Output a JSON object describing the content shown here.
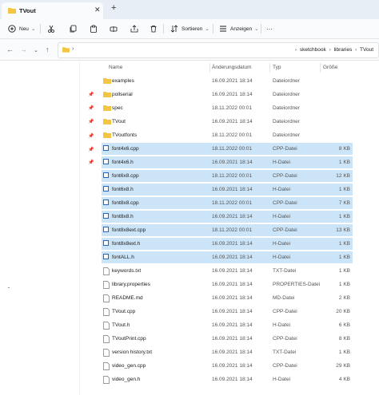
{
  "window": {
    "tab_title": "TVout",
    "colors": {
      "accent": "#0067c0",
      "selection": "#cce4f7",
      "folder": "#f4c542"
    }
  },
  "toolbar": {
    "new_label": "Neu",
    "sort_label": "Sortieren",
    "view_label": "Anzeigen",
    "more_label": "···"
  },
  "address": {
    "crumbs": [
      "sketchbook",
      "libraries",
      "TVout"
    ]
  },
  "columns": {
    "name": "Name",
    "date": "Änderungsdatum",
    "type": "Typ",
    "size": "Größe"
  },
  "files": [
    {
      "name": "examples",
      "date": "16.09.2021 18:14",
      "type": "Dateiordner",
      "size": "",
      "kind": "folder",
      "selected": false
    },
    {
      "name": "pollserial",
      "date": "16.09.2021 18:14",
      "type": "Dateiordner",
      "size": "",
      "kind": "folder",
      "selected": false
    },
    {
      "name": "spec",
      "date": "18.11.2022 00:01",
      "type": "Dateiordner",
      "size": "",
      "kind": "folder",
      "selected": false
    },
    {
      "name": "TVout",
      "date": "16.09.2021 18:14",
      "type": "Dateiordner",
      "size": "",
      "kind": "folder",
      "selected": false
    },
    {
      "name": "TVoutfonts",
      "date": "18.11.2022 00:01",
      "type": "Dateiordner",
      "size": "",
      "kind": "folder",
      "selected": false
    },
    {
      "name": "font4x6.cpp",
      "date": "18.11.2022 00:01",
      "type": "CPP-Datei",
      "size": "8 KB",
      "kind": "file",
      "selected": true
    },
    {
      "name": "font4x6.h",
      "date": "16.09.2021 18:14",
      "type": "H-Datei",
      "size": "1 KB",
      "kind": "file",
      "selected": true
    },
    {
      "name": "font6x8.cpp",
      "date": "18.11.2022 00:01",
      "type": "CPP-Datei",
      "size": "12 KB",
      "kind": "file",
      "selected": true
    },
    {
      "name": "font6x8.h",
      "date": "16.09.2021 18:14",
      "type": "H-Datei",
      "size": "1 KB",
      "kind": "file",
      "selected": true
    },
    {
      "name": "font8x8.cpp",
      "date": "18.11.2022 00:01",
      "type": "CPP-Datei",
      "size": "7 KB",
      "kind": "file",
      "selected": true
    },
    {
      "name": "font8x8.h",
      "date": "16.09.2021 18:14",
      "type": "H-Datei",
      "size": "1 KB",
      "kind": "file",
      "selected": true
    },
    {
      "name": "font8x8ext.cpp",
      "date": "18.11.2022 00:01",
      "type": "CPP-Datei",
      "size": "13 KB",
      "kind": "file",
      "selected": true
    },
    {
      "name": "font8x8ext.h",
      "date": "16.09.2021 18:14",
      "type": "H-Datei",
      "size": "1 KB",
      "kind": "file",
      "selected": true
    },
    {
      "name": "fontALL.h",
      "date": "16.09.2021 18:14",
      "type": "H-Datei",
      "size": "1 KB",
      "kind": "file",
      "selected": true
    },
    {
      "name": "keywords.txt",
      "date": "16.09.2021 18:14",
      "type": "TXT-Datei",
      "size": "1 KB",
      "kind": "file",
      "selected": false
    },
    {
      "name": "library.properties",
      "date": "16.09.2021 18:14",
      "type": "PROPERTIES-Datei",
      "size": "1 KB",
      "kind": "file",
      "selected": false
    },
    {
      "name": "README.md",
      "date": "16.09.2021 18:14",
      "type": "MD-Datei",
      "size": "2 KB",
      "kind": "file",
      "selected": false
    },
    {
      "name": "TVout.cpp",
      "date": "16.09.2021 18:14",
      "type": "CPP-Datei",
      "size": "20 KB",
      "kind": "file",
      "selected": false
    },
    {
      "name": "TVout.h",
      "date": "16.09.2021 18:14",
      "type": "H-Datei",
      "size": "6 KB",
      "kind": "file",
      "selected": false
    },
    {
      "name": "TVoutPrint.cpp",
      "date": "16.09.2021 18:14",
      "type": "CPP-Datei",
      "size": "8 KB",
      "kind": "file",
      "selected": false
    },
    {
      "name": "version history.txt",
      "date": "16.09.2021 18:14",
      "type": "TXT-Datei",
      "size": "1 KB",
      "kind": "file",
      "selected": false
    },
    {
      "name": "video_gen.cpp",
      "date": "16.09.2021 18:14",
      "type": "CPP-Datei",
      "size": "29 KB",
      "kind": "file",
      "selected": false
    },
    {
      "name": "video_gen.h",
      "date": "16.09.2021 18:14",
      "type": "H-Datei",
      "size": "4 KB",
      "kind": "file",
      "selected": false
    }
  ]
}
